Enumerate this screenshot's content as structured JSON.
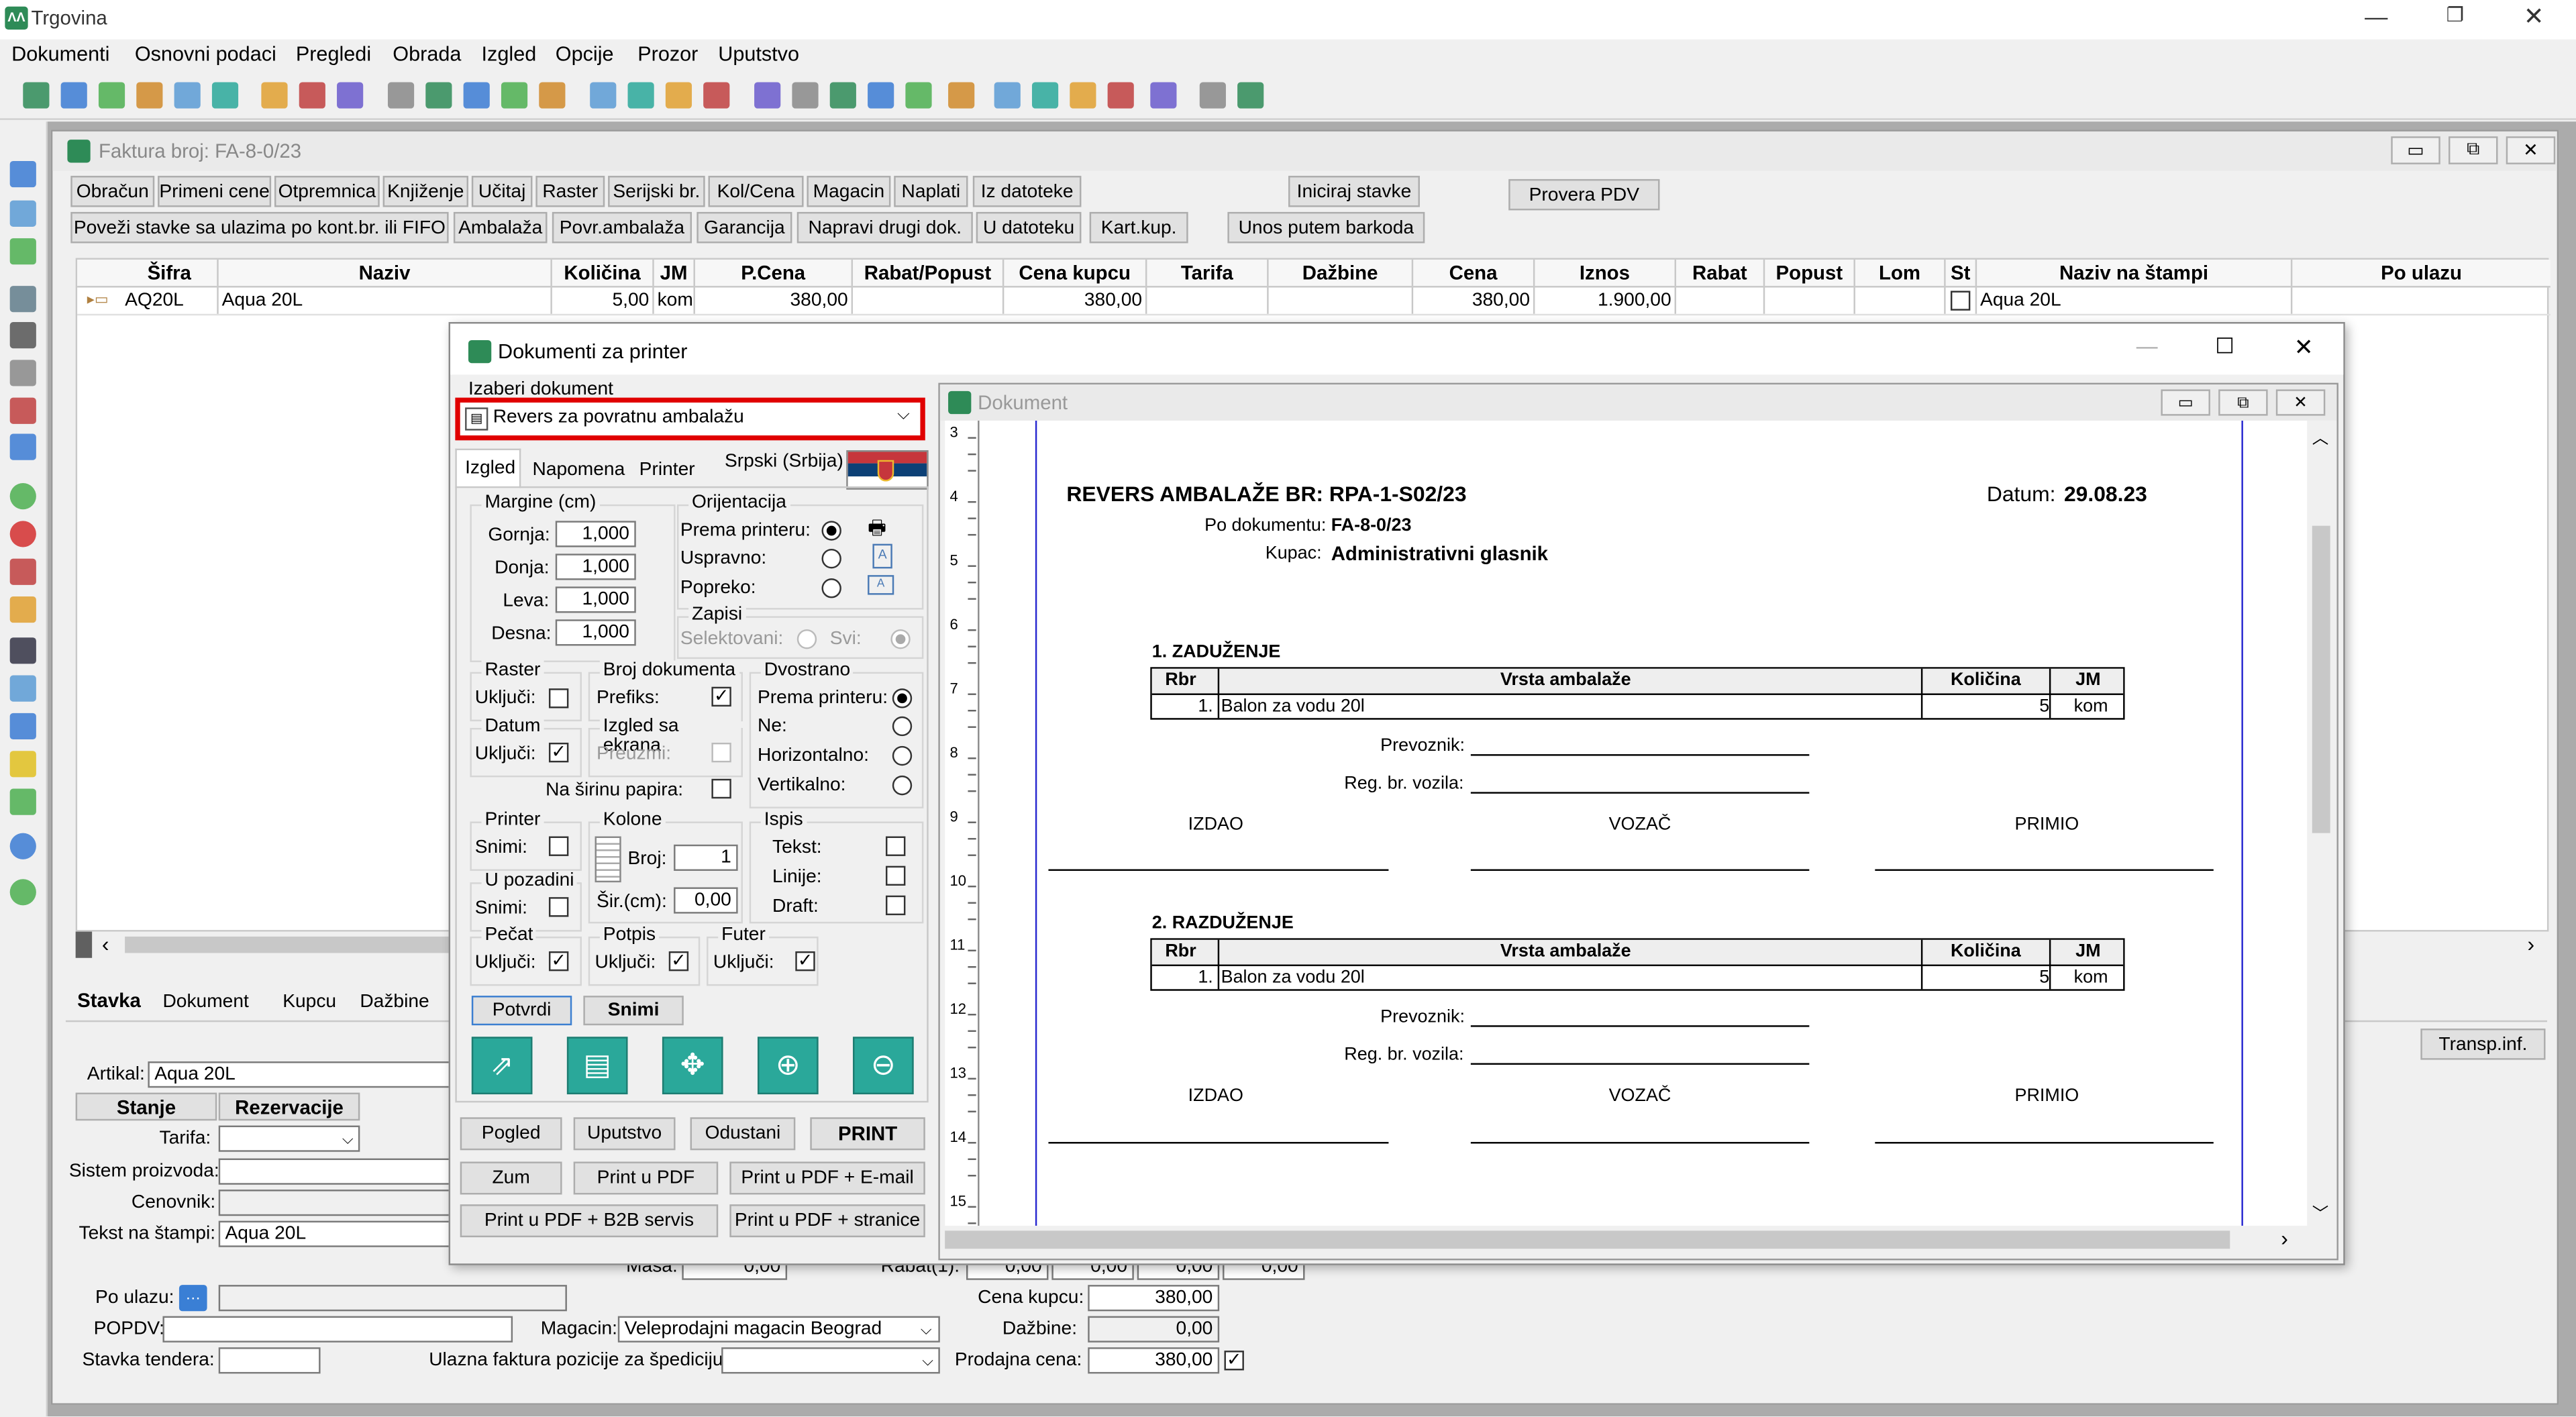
{
  "app": {
    "title": "Trgovina"
  },
  "menu": [
    "Dokumenti",
    "Osnovni podaci",
    "Pregledi",
    "Obrada",
    "Izgled",
    "Opcije",
    "Prozor",
    "Uputstvo"
  ],
  "faktura": {
    "title": "Faktura broj: FA-8-0/23",
    "row1_buttons": [
      "Obračun",
      "Primeni cene",
      "Otpremnica",
      "Knjiženje",
      "Učitaj",
      "Raster",
      "Serijski br.",
      "Kol/Cena",
      "Magacin",
      "Naplati",
      "Iz datoteke"
    ],
    "iniciraj": "Iniciraj stavke",
    "provera": "Provera PDV",
    "row2_buttons": [
      "Poveži stavke sa ulazima po kont.br. ili FIFO",
      "Ambalaža",
      "Povr.ambalaža",
      "Garancija",
      "Napravi drugi dok.",
      "U datoteku",
      "Kart.kup."
    ],
    "unos": "Unos putem barkoda",
    "columns": [
      "Šifra",
      "Naziv",
      "Količina",
      "JM",
      "P.Cena",
      "Rabat/Popust",
      "Cena kupcu",
      "Tarifa",
      "Dažbine",
      "Cena",
      "Iznos",
      "Rabat",
      "Popust",
      "Lom",
      "St",
      "Naziv na štampi",
      "Po ulazu"
    ],
    "row": {
      "sifra": "AQ20L",
      "naziv": "Aqua 20L",
      "kolicina": "5,00",
      "jm": "kom",
      "pcena": "380,00",
      "cena_kupcu": "380,00",
      "cena": "380,00",
      "iznos": "1.900,00",
      "naziv_stampa": "Aqua 20L"
    },
    "tabs": [
      "Stavka",
      "Dokument",
      "Kupcu",
      "Dažbine"
    ],
    "transp": "Transp.inf.",
    "artikal_label": "Artikal:",
    "artikal_value": "Aqua 20L",
    "stanje": "Stanje",
    "rezervacije": "Rezervacije",
    "tarifa_label": "Tarifa:",
    "sistem_label": "Sistem proizvoda:",
    "cenovnik_label": "Cenovnik:",
    "tekst_label": "Tekst na štampi:",
    "tekst_value": "Aqua 20L",
    "masa_label": "Masa:",
    "masa_value": "0,00",
    "rabat1_label": "Rabat(1):",
    "rabat_values": [
      "0,00",
      "0,00",
      "0,00",
      "0,00"
    ],
    "po_ulazu_label": "Po ulazu:",
    "popdv_label": "POPDV:",
    "magacin_label": "Magacin:",
    "magacin_value": "Veleprodajni magacin Beograd",
    "stavka_tendera_label": "Stavka tendera:",
    "ulazna_label": "Ulazna faktura pozicije za špediciju:",
    "cena_kupcu_label": "Cena kupcu:",
    "cena_kupcu_value": "380,00",
    "dazbine_label": "Dažbine:",
    "dazbine_value": "0,00",
    "prodajna_label": "Prodajna cena:",
    "prodajna_value": "380,00"
  },
  "dialog": {
    "title": "Dokumenti za printer",
    "izaberi": "Izaberi dokument",
    "selected": "Revers za povratnu ambalažu",
    "tabs": [
      "Izgled",
      "Napomena",
      "Printer"
    ],
    "language": "Srpski (Srbija)",
    "margine": {
      "title": "Margine (cm)",
      "gornja": "Gornja:",
      "donja": "Donja:",
      "leva": "Leva:",
      "desna": "Desna:",
      "values": [
        "1,000",
        "1,000",
        "1,000",
        "1,000"
      ]
    },
    "orijentacija": {
      "title": "Orijentacija",
      "prema": "Prema printeru:",
      "uspravno": "Uspravno:",
      "popreko": "Popreko:"
    },
    "zapisi": {
      "title": "Zapisi",
      "selektovani": "Selektovani:",
      "svi": "Svi:"
    },
    "raster": {
      "title": "Raster",
      "ukljuci": "Uključi:"
    },
    "broj_dok": {
      "title": "Broj dokumenta",
      "prefiks": "Prefiks:"
    },
    "dvostrano": {
      "title": "Dvostrano",
      "prema": "Prema printeru:",
      "ne": "Ne:",
      "horiz": "Horizontalno:",
      "vert": "Vertikalno:"
    },
    "datum": {
      "title": "Datum",
      "ukljuci": "Uključi:"
    },
    "izgled_ekrana": {
      "title": "Izgled sa ekrana",
      "preuzmi": "Preuzmi:"
    },
    "na_sirinu": "Na širinu papira:",
    "printer": {
      "title": "Printer",
      "snimi": "Snimi:"
    },
    "kolone": {
      "title": "Kolone",
      "broj": "Broj:",
      "broj_value": "1",
      "sir": "Šir.(cm):",
      "sir_value": "0,00"
    },
    "ispis": {
      "title": "Ispis",
      "tekst": "Tekst:",
      "linije": "Linije:",
      "draft": "Draft:"
    },
    "pozadina": {
      "title": "U pozadini",
      "snimi": "Snimi:"
    },
    "pecat": {
      "title": "Pečat",
      "ukljuci": "Uključi:"
    },
    "potpis": {
      "title": "Potpis",
      "ukljuci": "Uključi:"
    },
    "futer": {
      "title": "Futer",
      "ukljuci": "Uključi:"
    },
    "potvrdi": "Potvrdi",
    "snimi": "Snimi",
    "buttons_row1": [
      "Pogled",
      "Uputstvo",
      "Odustani",
      "PRINT"
    ],
    "buttons_row2": [
      "Zum",
      "Print u PDF",
      "Print u PDF + E-mail"
    ],
    "buttons_row3": [
      "Print u PDF + B2B servis",
      "Print u PDF + stranice"
    ]
  },
  "preview": {
    "title": "Dokument",
    "heading": "REVERS AMBALAŽE BR: RPA-1-S02/23",
    "datum_label": "Datum:",
    "datum_value": "29.08.23",
    "po_dok_label": "Po dokumentu:",
    "po_dok_value": "FA-8-0/23",
    "kupac_label": "Kupac:",
    "kupac_value": "Administrativni glasnik",
    "sec1": "1. ZADUŽENJE",
    "sec2": "2. RAZDUŽENJE",
    "cols": [
      "Rbr",
      "Vrsta ambalaže",
      "Količina",
      "JM"
    ],
    "row": {
      "rbr": "1.",
      "vrsta": "Balon za vodu 20l",
      "kol": "5",
      "jm": "kom"
    },
    "prevoznik": "Prevoznik:",
    "reg": "Reg. br. vozila:",
    "izdao": "IZDAO",
    "vozac": "VOZAČ",
    "primio": "PRIMIO",
    "ruler": [
      "3",
      "4",
      "5",
      "6",
      "7",
      "8",
      "9",
      "10",
      "11",
      "12",
      "13",
      "14",
      "15"
    ]
  }
}
